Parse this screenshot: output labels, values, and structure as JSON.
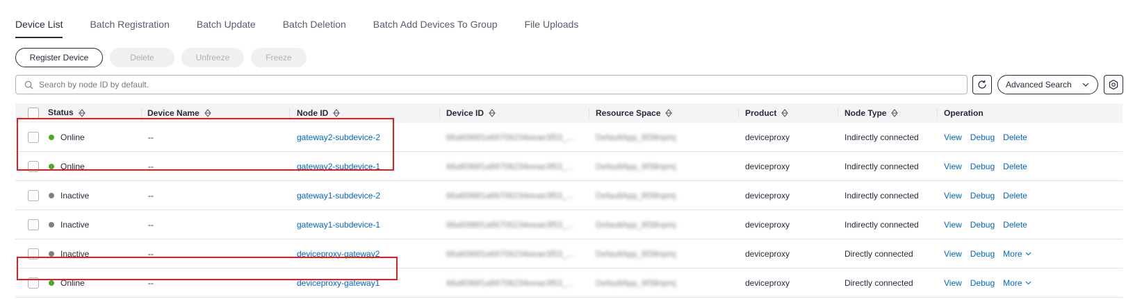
{
  "tabs": [
    {
      "label": "Device List",
      "active": true
    },
    {
      "label": "Batch Registration"
    },
    {
      "label": "Batch Update"
    },
    {
      "label": "Batch Deletion"
    },
    {
      "label": "Batch Add Devices To Group"
    },
    {
      "label": "File Uploads"
    }
  ],
  "toolbar": {
    "register_label": "Register Device",
    "delete_label": "Delete",
    "unfreeze_label": "Unfreeze",
    "freeze_label": "Freeze"
  },
  "search": {
    "placeholder": "Search by node ID by default.",
    "advanced_label": "Advanced Search"
  },
  "columns": {
    "status": "Status",
    "device_name": "Device Name",
    "node_id": "Node ID",
    "device_id": "Device ID",
    "resource_space": "Resource Space",
    "product": "Product",
    "node_type": "Node Type",
    "operation": "Operation"
  },
  "colors": {
    "online": "#52a72a",
    "inactive": "#808080",
    "link": "#0066cc",
    "highlight": "#e02020"
  },
  "rows": [
    {
      "status": "Online",
      "device_name": "--",
      "node_id": "gateway2-subdevice-2",
      "device_id": "66a6086f1a66706234eeae3f53_...",
      "resource_space": "DefaultApp_6f38npmj",
      "product": "deviceproxy",
      "node_type": "Indirectly connected",
      "op1": "View",
      "op2": "Debug",
      "op3": "Delete"
    },
    {
      "status": "Online",
      "device_name": "--",
      "node_id": "gateway2-subdevice-1",
      "device_id": "66a6086f1a66706234eeae3f53_...",
      "resource_space": "DefaultApp_6f38npmj",
      "product": "deviceproxy",
      "node_type": "Indirectly connected",
      "op1": "View",
      "op2": "Debug",
      "op3": "Delete"
    },
    {
      "status": "Inactive",
      "device_name": "--",
      "node_id": "gateway1-subdevice-2",
      "device_id": "66a6086f1a66706234eeae3f53_...",
      "resource_space": "DefaultApp_6f38npmj",
      "product": "deviceproxy",
      "node_type": "Indirectly connected",
      "op1": "View",
      "op2": "Debug",
      "op3": "Delete"
    },
    {
      "status": "Inactive",
      "device_name": "--",
      "node_id": "gateway1-subdevice-1",
      "device_id": "66a6086f1a66706234eeae3f53_...",
      "resource_space": "DefaultApp_6f38npmj",
      "product": "deviceproxy",
      "node_type": "Indirectly connected",
      "op1": "View",
      "op2": "Debug",
      "op3": "Delete"
    },
    {
      "status": "Inactive",
      "device_name": "--",
      "node_id": "deviceproxy-gateway2",
      "device_id": "66a6086f1a66706234eeae3f53_...",
      "resource_space": "DefaultApp_6f38npmj",
      "product": "deviceproxy",
      "node_type": "Directly connected",
      "op1": "View",
      "op2": "Debug",
      "op3": "More"
    },
    {
      "status": "Online",
      "device_name": "--",
      "node_id": "deviceproxy-gateway1",
      "device_id": "66a6086f1a66706234eeae3f53_...",
      "resource_space": "DefaultApp_6f38npmj",
      "product": "deviceproxy",
      "node_type": "Directly connected",
      "op1": "View",
      "op2": "Debug",
      "op3": "More"
    }
  ]
}
